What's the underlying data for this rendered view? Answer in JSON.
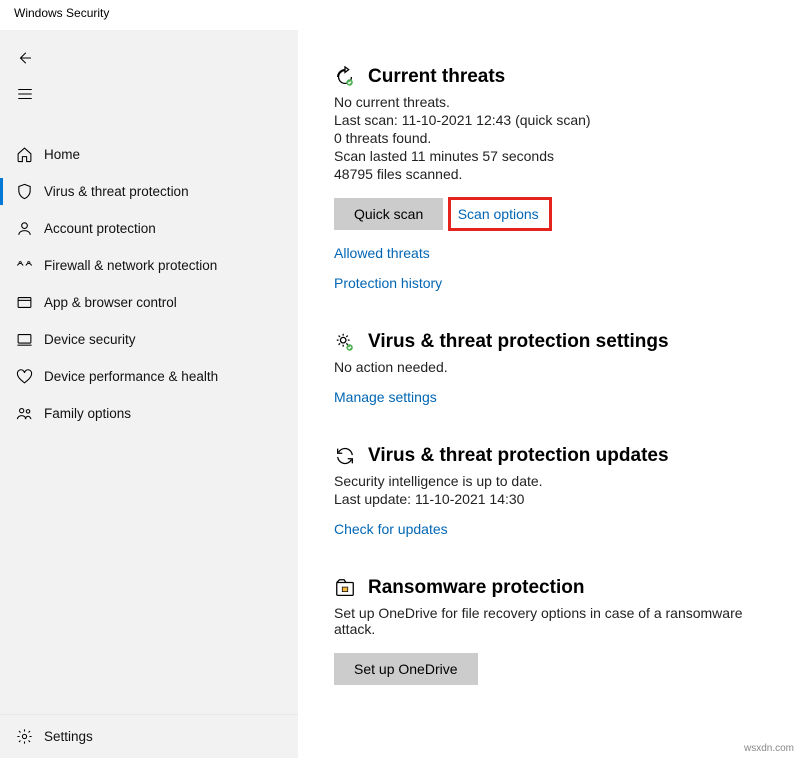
{
  "window": {
    "title": "Windows Security"
  },
  "sidebar": {
    "items": [
      {
        "label": "Home"
      },
      {
        "label": "Virus & threat protection"
      },
      {
        "label": "Account protection"
      },
      {
        "label": "Firewall & network protection"
      },
      {
        "label": "App & browser control"
      },
      {
        "label": "Device security"
      },
      {
        "label": "Device performance & health"
      },
      {
        "label": "Family options"
      }
    ],
    "settings": "Settings"
  },
  "threats": {
    "heading": "Current threats",
    "line1": "No current threats.",
    "line2": "Last scan: 11-10-2021 12:43 (quick scan)",
    "line3": "0 threats found.",
    "line4": "Scan lasted 11 minutes 57 seconds",
    "line5": "48795 files scanned.",
    "quick_scan": "Quick scan",
    "scan_options": "Scan options",
    "allowed_threats": "Allowed threats",
    "protection_history": "Protection history"
  },
  "settings_section": {
    "heading": "Virus & threat protection settings",
    "line1": "No action needed.",
    "manage_link": "Manage settings"
  },
  "updates": {
    "heading": "Virus & threat protection updates",
    "line1": "Security intelligence is up to date.",
    "line2": "Last update: 11-10-2021 14:30",
    "check_link": "Check for updates"
  },
  "ransomware": {
    "heading": "Ransomware protection",
    "line1": "Set up OneDrive for file recovery options in case of a ransomware attack.",
    "setup_btn": "Set up OneDrive"
  },
  "watermark": "wsxdn.com"
}
